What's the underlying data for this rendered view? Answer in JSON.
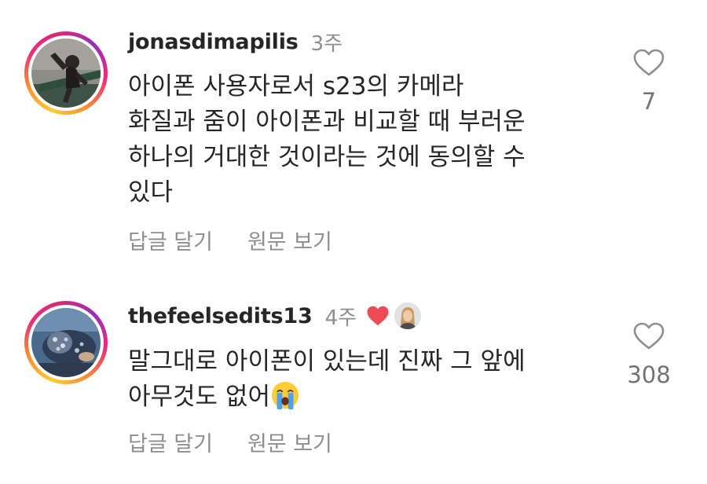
{
  "comments": [
    {
      "username": "jonasdimapilis",
      "time": "3주",
      "text": "아이폰 사용자로서 s23의 카메라\n화질과 줌이 아이폰과 비교할 때 부러운\n하나의 거대한 것이라는 것에 동의할 수\n있다",
      "like_count": "7",
      "reply_label": "답글 달기",
      "translate_label": "원문 보기",
      "icons": {
        "like": "heart-outline-icon"
      }
    },
    {
      "username": "thefeelsedits13",
      "time": "4주",
      "text": "말그대로 아이폰이 있는데 진짜 그 앞에\n아무것도 없어",
      "emoji": "crying-face-emoji",
      "like_count": "308",
      "reply_label": "답글 달기",
      "translate_label": "원문 보기",
      "icons": {
        "creator_like": "red-heart-icon",
        "like": "heart-outline-icon"
      }
    }
  ],
  "colors": {
    "text": "#262626",
    "secondary": "#8e8e8e",
    "heart_red": "#ed4956",
    "story_ring": [
      "#f9ce34",
      "#ee2a7b",
      "#962fbf"
    ]
  }
}
